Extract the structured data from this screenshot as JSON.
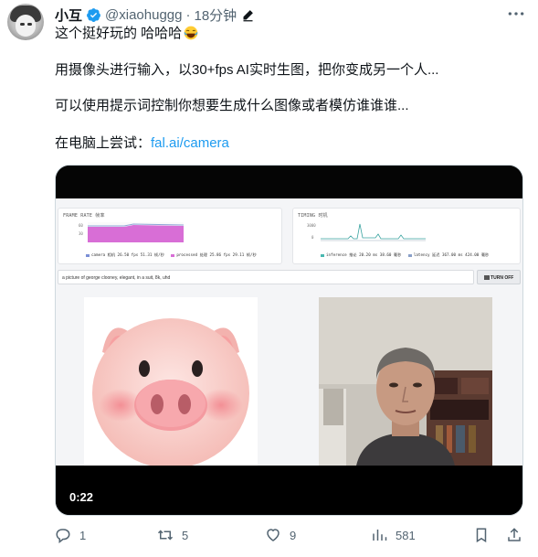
{
  "author": {
    "name": "小互",
    "handle": "@xiaohuggg",
    "separator": "·",
    "time": "18分钟"
  },
  "tweet": {
    "line1": "这个挺好玩的 哈哈哈",
    "line2": "用摄像头进行输入，以30+fps AI实时生图，把你变成另一个人...",
    "line3": "可以使用提示词控制你想要生成什么图像或者模仿谁谁谁...",
    "try_prefix": "在电脑上尝试：",
    "try_link": "fal.ai/camera"
  },
  "video": {
    "timestamp": "0:22",
    "app": {
      "frame_rate_title": "FRAME RATE 帧率",
      "frame_rate_axis": [
        "60",
        "30"
      ],
      "camera_legend": "camera 相机 26.50 fps 51.31 帧/秒",
      "processed_legend": "processed 处理 25.86 fps 29.11 帧/秒",
      "timing_title": "TIMING 时机",
      "timing_axis": [
        "3000",
        "0"
      ],
      "inference_legend": "inference 推论 20.20 ms 38.60 毫秒",
      "latency_legend": "latency 延迟 367.00 ms 424.00 毫秒",
      "prompt_value": "a picture of george clooney, elegant, in a suit, 8k, uhd",
      "turn_off_label": "TURN OFF"
    }
  },
  "actions": {
    "replies": "1",
    "retweets": "5",
    "likes": "9",
    "views": "581"
  },
  "colors": {
    "link": "#1d9bf0",
    "muted": "#536471",
    "verified": "#1d9bf0",
    "frame_rate_fill": "#d86ed6",
    "timing_line": "#3aa3a0"
  }
}
